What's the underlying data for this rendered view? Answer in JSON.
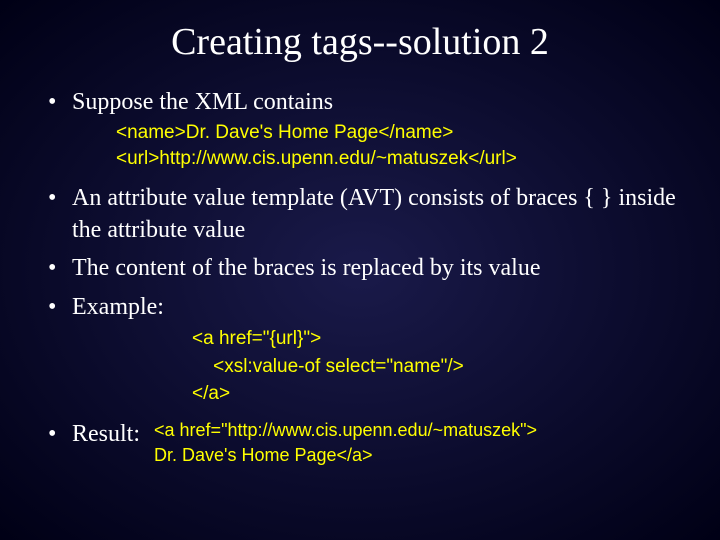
{
  "title": "Creating tags--solution 2",
  "bullets": {
    "b1": "Suppose the XML contains",
    "b2": "An attribute value template (AVT) consists of braces { } inside the attribute value",
    "b3": "The content of the braces is replaced by its value",
    "b4": "Example:",
    "b5": "Result:"
  },
  "code": {
    "xml1": "<name>Dr. Dave's Home Page</name>",
    "xml2": "<url>http://www.cis.upenn.edu/~matuszek</url>",
    "ex1": "<a href=\"{url}\">",
    "ex2": "    <xsl:value-of select=\"name\"/>",
    "ex3": "</a>",
    "res1": "<a href=\"http://www.cis.upenn.edu/~matuszek\">",
    "res2": "Dr. Dave's Home Page</a>"
  }
}
